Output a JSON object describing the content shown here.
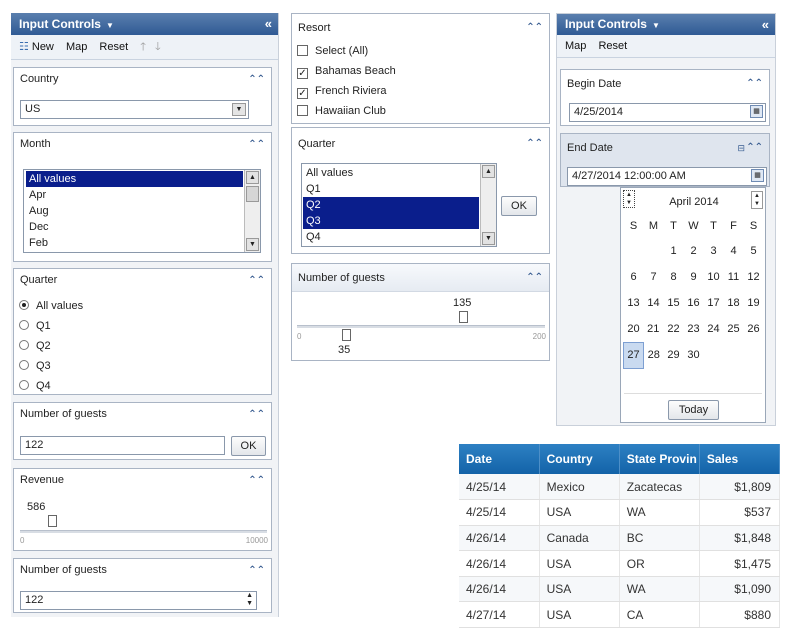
{
  "left": {
    "title": "Input Controls",
    "toolbar": {
      "new": "New",
      "map": "Map",
      "reset": "Reset"
    },
    "country": {
      "label": "Country",
      "value": "US"
    },
    "month": {
      "label": "Month",
      "items": [
        "All values",
        "Apr",
        "Aug",
        "Dec",
        "Feb"
      ],
      "selected_index": 0
    },
    "quarter": {
      "label": "Quarter",
      "options": [
        "All values",
        "Q1",
        "Q2",
        "Q3",
        "Q4"
      ],
      "selected_index": 0
    },
    "guests": {
      "label": "Number of guests",
      "value": "122",
      "ok": "OK"
    },
    "revenue": {
      "label": "Revenue",
      "value": "586",
      "min": "0",
      "max": "10000",
      "fraction": 0.0586
    },
    "guests2": {
      "label": "Number of guests",
      "value": "122"
    }
  },
  "middle": {
    "resort": {
      "label": "Resort",
      "options": [
        {
          "text": "Select (All)",
          "checked": false
        },
        {
          "text": "Bahamas Beach",
          "checked": true
        },
        {
          "text": "French Riviera",
          "checked": true
        },
        {
          "text": "Hawaiian Club",
          "checked": false
        }
      ]
    },
    "quarter": {
      "label": "Quarter",
      "items": [
        "All values",
        "Q1",
        "Q2",
        "Q3",
        "Q4"
      ],
      "selected": [
        2,
        3
      ],
      "ok": "OK"
    },
    "guests": {
      "label": "Number of guests",
      "upper": "135",
      "lower": "35",
      "min": "0",
      "max": "200"
    }
  },
  "right": {
    "title": "Input Controls",
    "toolbar": {
      "map": "Map",
      "reset": "Reset"
    },
    "begin": {
      "label": "Begin Date",
      "value": "4/25/2014"
    },
    "end": {
      "label": "End Date",
      "value": "4/27/2014 12:00:00 AM"
    },
    "calendar": {
      "month": "April 2014",
      "days": [
        "S",
        "M",
        "T",
        "W",
        "T",
        "F",
        "S"
      ],
      "weeks": [
        [
          "",
          "",
          "1",
          "2",
          "3",
          "4",
          "5"
        ],
        [
          "6",
          "7",
          "8",
          "9",
          "10",
          "11",
          "12"
        ],
        [
          "13",
          "14",
          "15",
          "16",
          "17",
          "18",
          "19"
        ],
        [
          "20",
          "21",
          "22",
          "23",
          "24",
          "25",
          "26"
        ],
        [
          "27",
          "28",
          "29",
          "30",
          "",
          "",
          ""
        ]
      ],
      "selected": "27",
      "today_btn": "Today"
    }
  },
  "table": {
    "columns": [
      "Date",
      "Country",
      "State Provin",
      "Sales"
    ],
    "rows": [
      [
        "4/25/14",
        "Mexico",
        "Zacatecas",
        "$1,809"
      ],
      [
        "4/25/14",
        "USA",
        "WA",
        "$537"
      ],
      [
        "4/26/14",
        "Canada",
        "BC",
        "$1,848"
      ],
      [
        "4/26/14",
        "USA",
        "OR",
        "$1,475"
      ],
      [
        "4/26/14",
        "USA",
        "WA",
        "$1,090"
      ],
      [
        "4/27/14",
        "USA",
        "CA",
        "$880"
      ]
    ]
  },
  "colors": {
    "accent": "#2f5a94",
    "selection": "#0a1e8c",
    "table_header": "#1a6fb5"
  }
}
